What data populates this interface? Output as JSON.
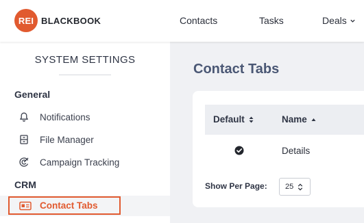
{
  "header": {
    "logo_mark": "REI",
    "logo_text": "BLACKBOOK",
    "nav": {
      "contacts": "Contacts",
      "tasks": "Tasks",
      "deals": "Deals"
    }
  },
  "sidebar": {
    "title": "SYSTEM SETTINGS",
    "sections": {
      "general": "General",
      "crm": "CRM"
    },
    "items": {
      "notifications": "Notifications",
      "file_manager": "File Manager",
      "campaign_tracking": "Campaign Tracking",
      "contact_tabs": "Contact Tabs"
    },
    "active_item": "contact_tabs"
  },
  "main": {
    "title": "Contact Tabs",
    "table": {
      "columns": [
        "Default",
        "Name"
      ],
      "rows": [
        {
          "default": true,
          "name": "Details"
        }
      ]
    },
    "per_page": {
      "label": "Show Per Page:",
      "value": "25"
    }
  },
  "colors": {
    "brand": "#e15a2f",
    "title": "#4a5774",
    "background": "#f0f1f4"
  }
}
